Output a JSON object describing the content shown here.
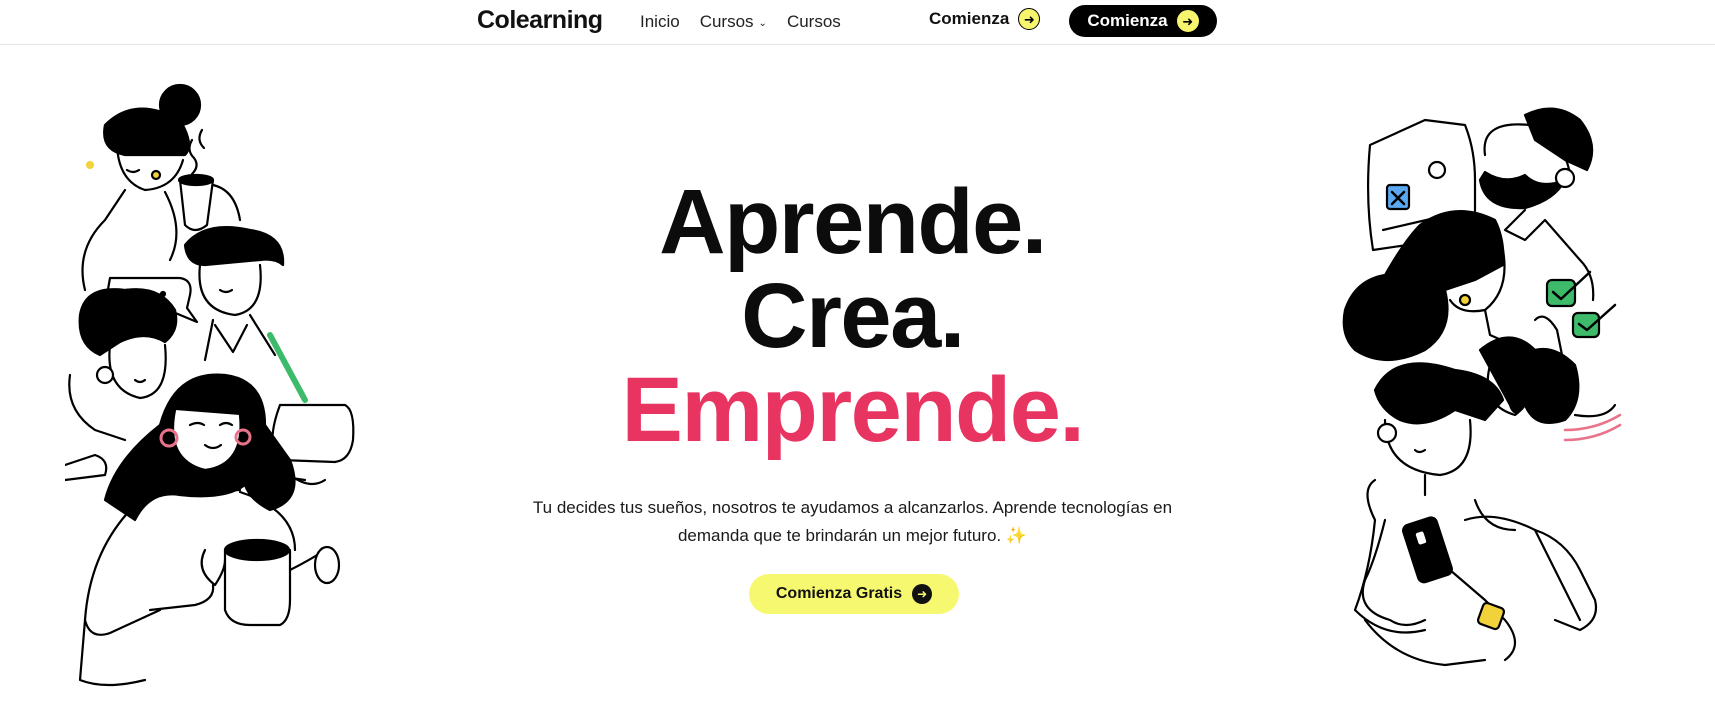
{
  "header": {
    "logo": "Colearning",
    "nav": [
      {
        "label": "Inicio"
      },
      {
        "label": "Cursos",
        "has_dropdown": true
      },
      {
        "label": "Cursos"
      }
    ],
    "cta_plain": "Comienza",
    "cta_dark": "Comienza"
  },
  "hero": {
    "line1": "Aprende.",
    "line2": "Crea.",
    "line3": "Emprende.",
    "subtitle_1": "Tu decides tus sueños, nosotros te ayudamos a alcanzarlos. Aprende tecnologías en",
    "subtitle_2": "demanda que te brindarán un mejor futuro.",
    "sparkle": "✨",
    "button": "Comienza Gratis"
  },
  "colors": {
    "accent": "#e83461",
    "highlight": "#f6f96f",
    "dark": "#000000"
  },
  "icons": [
    "arrow-right-icon",
    "chevron-down-icon",
    "sparkle-icon"
  ]
}
